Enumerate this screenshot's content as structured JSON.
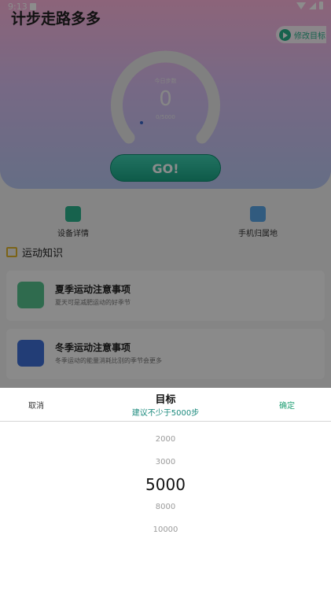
{
  "status_bar": {
    "time": "9:13"
  },
  "app": {
    "title": "计步走路多多",
    "goal_button_label": "修改目标",
    "gauge": {
      "today_label": "今日步数",
      "steps": "0",
      "unit_label": "0/5000"
    },
    "go_label": "GO!"
  },
  "shortcuts": [
    {
      "label": "设备详情",
      "icon": "calendar-icon"
    },
    {
      "label": "手机归属地",
      "icon": "location-icon"
    }
  ],
  "knowledge": {
    "heading": "运动知识",
    "cards": [
      {
        "title": "夏季运动注意事项",
        "subtitle": "夏天可是减肥运动的好季节",
        "icon": "runner-icon"
      },
      {
        "title": "冬季运动注意事项",
        "subtitle": "冬季运动的能量消耗比别的季节会更多",
        "icon": "skate-icon"
      }
    ]
  },
  "picker": {
    "cancel_label": "取消",
    "title": "目标",
    "hint": "建议不少于5000步",
    "confirm_label": "确定",
    "options": [
      "2000",
      "3000",
      "5000",
      "8000",
      "10000"
    ],
    "selected": "5000"
  },
  "colors": {
    "accent": "#1f9e73",
    "hint": "#1b8a7d"
  }
}
